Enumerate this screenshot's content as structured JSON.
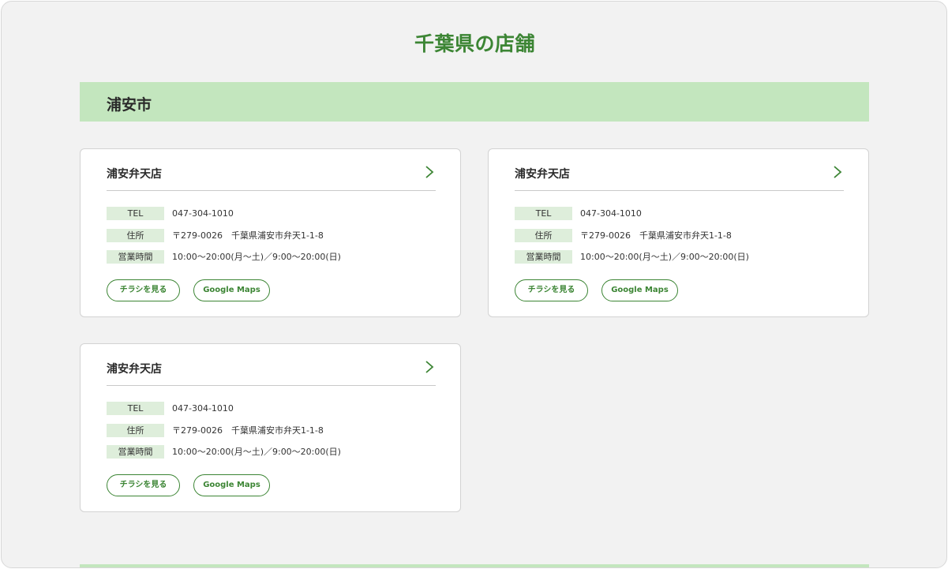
{
  "page": {
    "title": "千葉県の店舗",
    "accent_color": "#3c8534",
    "band_color": "#c3e6be"
  },
  "section": {
    "city": "浦安市"
  },
  "icons": {
    "chevron": "chevron-right-icon"
  },
  "stores": [
    {
      "name": "浦安弁天店",
      "tel_label": "TEL",
      "tel": "047-304-1010",
      "address_label": "住所",
      "address": "〒279-0026　千葉県浦安市弁天1-1-8",
      "hours_label": "営業時間",
      "hours": "10:00〜20:00(月〜土)／9:00〜20:00(日)",
      "flyer_label": "チラシを見る",
      "maps_label": "Google Maps"
    },
    {
      "name": "浦安弁天店",
      "tel_label": "TEL",
      "tel": "047-304-1010",
      "address_label": "住所",
      "address": "〒279-0026　千葉県浦安市弁天1-1-8",
      "hours_label": "営業時間",
      "hours": "10:00〜20:00(月〜土)／9:00〜20:00(日)",
      "flyer_label": "チラシを見る",
      "maps_label": "Google Maps"
    },
    {
      "name": "浦安弁天店",
      "tel_label": "TEL",
      "tel": "047-304-1010",
      "address_label": "住所",
      "address": "〒279-0026　千葉県浦安市弁天1-1-8",
      "hours_label": "営業時間",
      "hours": "10:00〜20:00(月〜土)／9:00〜20:00(日)",
      "flyer_label": "チラシを見る",
      "maps_label": "Google Maps"
    }
  ]
}
